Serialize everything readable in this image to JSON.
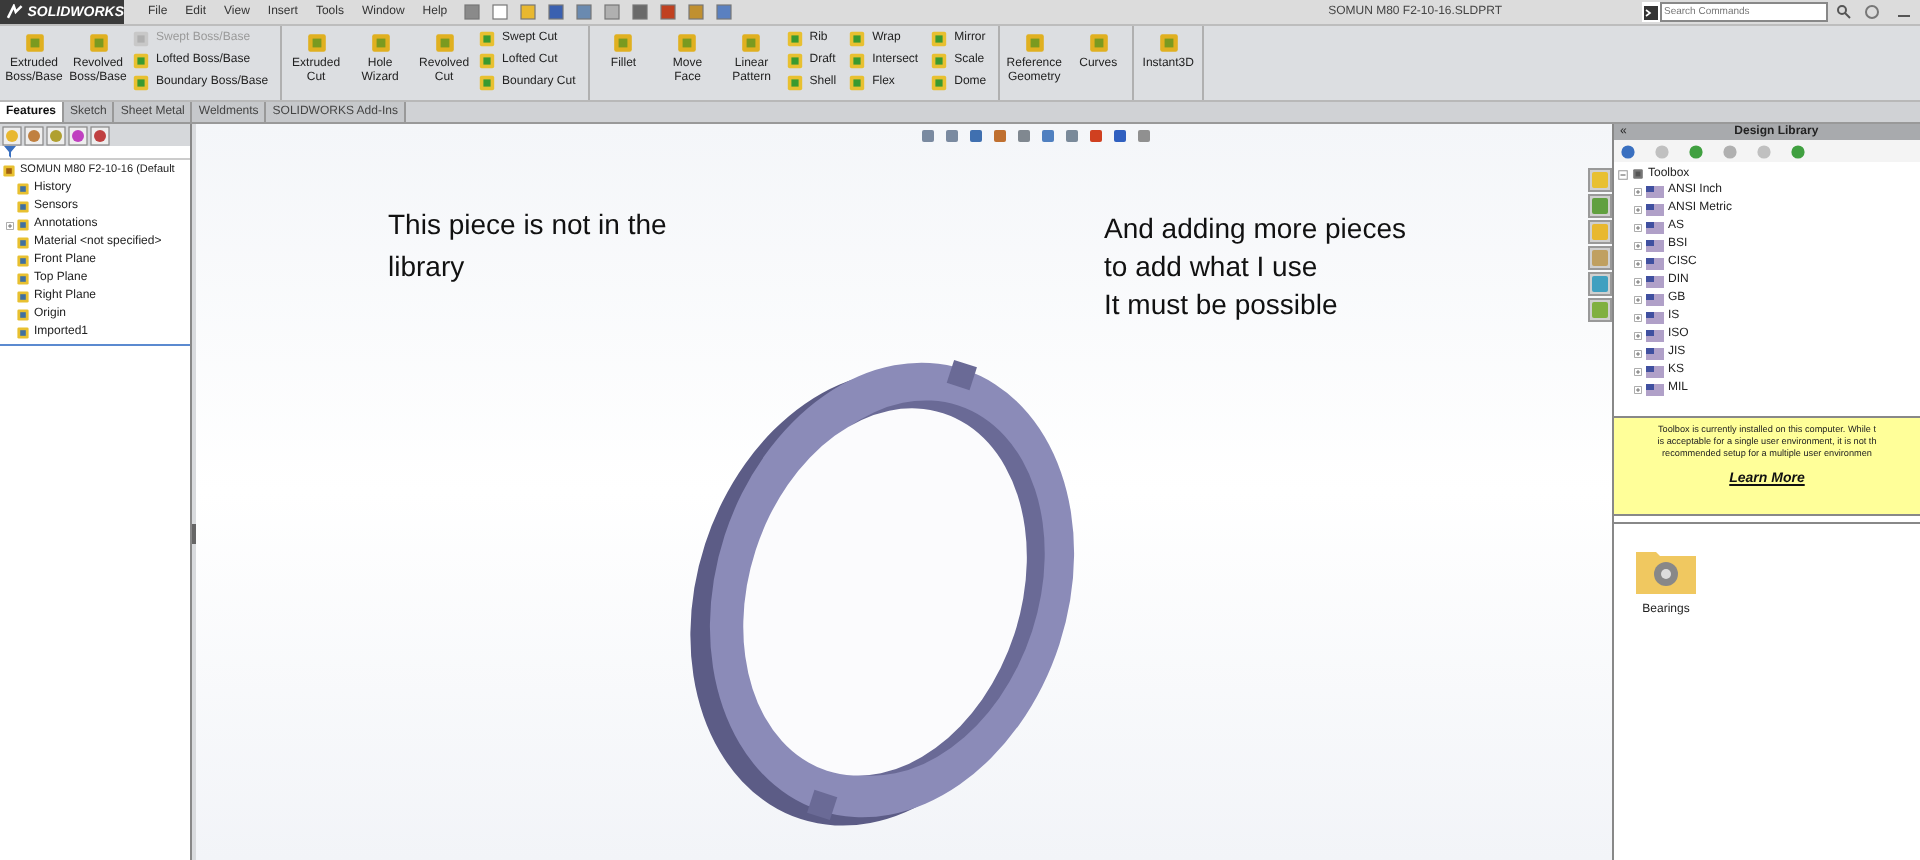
{
  "app": {
    "logo": "SOLIDWORKS",
    "menu": [
      "File",
      "Edit",
      "View",
      "Insert",
      "Tools",
      "Window",
      "Help"
    ],
    "document_title": "SOMUN M80 F2-10-16.SLDPRT",
    "search": {
      "placeholder": "Search Commands"
    }
  },
  "ribbon": {
    "groups": [
      {
        "large": [
          "Extruded Boss/Base",
          "Revolved Boss/Base"
        ],
        "small": [
          [
            {
              "label": "Swept Boss/Base",
              "disabled": true
            },
            {
              "label": "Lofted Boss/Base",
              "disabled": false
            },
            {
              "label": "Boundary Boss/Base",
              "disabled": false
            }
          ]
        ]
      },
      {
        "large": [
          "Extruded Cut",
          "Hole Wizard",
          "Revolved Cut"
        ],
        "small": [
          [
            {
              "label": "Swept Cut",
              "disabled": false
            },
            {
              "label": "Lofted Cut",
              "disabled": false
            },
            {
              "label": "Boundary Cut",
              "disabled": false
            }
          ]
        ]
      },
      {
        "large": [
          "Fillet",
          "Move Face",
          "Linear Pattern"
        ],
        "small": [
          [
            {
              "label": "Rib",
              "disabled": false
            },
            {
              "label": "Draft",
              "disabled": false
            },
            {
              "label": "Shell",
              "disabled": false
            }
          ],
          [
            {
              "label": "Wrap",
              "disabled": false
            },
            {
              "label": "Intersect",
              "disabled": false
            },
            {
              "label": "Flex",
              "disabled": false
            }
          ],
          [
            {
              "label": "Mirror",
              "disabled": false
            },
            {
              "label": "Scale",
              "disabled": false
            },
            {
              "label": "Dome",
              "disabled": false
            }
          ]
        ]
      },
      {
        "large": [
          "Reference Geometry",
          "Curves"
        ]
      },
      {
        "large": [
          "Instant3D"
        ]
      }
    ]
  },
  "ribbon_tabs": [
    {
      "label": "Features",
      "selected": true
    },
    {
      "label": "Sketch",
      "selected": false
    },
    {
      "label": "Sheet Metal",
      "selected": false
    },
    {
      "label": "Weldments",
      "selected": false
    },
    {
      "label": "SOLIDWORKS Add-Ins",
      "selected": false
    }
  ],
  "feature_tree": {
    "root": "SOMUN M80 F2-10-16  (Default",
    "items": [
      {
        "label": "History",
        "expandable": false
      },
      {
        "label": "Sensors",
        "expandable": false
      },
      {
        "label": "Annotations",
        "expandable": true
      },
      {
        "label": "Material <not specified>",
        "expandable": false
      },
      {
        "label": "Front Plane",
        "expandable": false
      },
      {
        "label": "Top Plane",
        "expandable": false
      },
      {
        "label": "Right Plane",
        "expandable": false
      },
      {
        "label": "Origin",
        "expandable": false
      },
      {
        "label": "Imported1",
        "expandable": false
      }
    ]
  },
  "viewport": {
    "notes": [
      {
        "lines": [
          "This piece is not in the",
          "library"
        ]
      },
      {
        "lines": [
          "And adding more pieces",
          "to add what I use",
          "It must be possible"
        ]
      }
    ]
  },
  "design_library": {
    "collapse": "«",
    "title": "Design Library",
    "tree": {
      "label": "Toolbox",
      "expanded": true,
      "children": [
        {
          "label": "ANSI Inch"
        },
        {
          "label": "ANSI Metric"
        },
        {
          "label": "AS"
        },
        {
          "label": "BSI"
        },
        {
          "label": "CISC"
        },
        {
          "label": "DIN"
        },
        {
          "label": "GB"
        },
        {
          "label": "IS"
        },
        {
          "label": "ISO"
        },
        {
          "label": "JIS"
        },
        {
          "label": "KS"
        },
        {
          "label": "MIL"
        }
      ]
    },
    "notice": {
      "lines": [
        "Toolbox is currently installed on this computer. While t",
        "is acceptable for a single user environment, it is not th",
        "recommended setup for a multiple user environmen"
      ],
      "link": "Learn More"
    },
    "folders": [
      {
        "label": "Bearings"
      }
    ]
  }
}
